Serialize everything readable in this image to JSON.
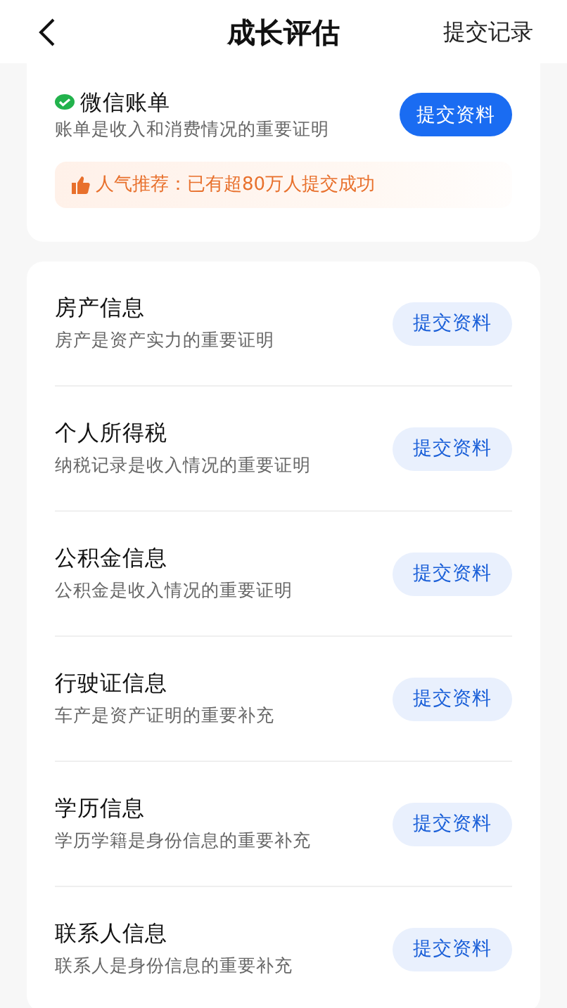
{
  "header": {
    "title": "成长评估",
    "action": "提交记录"
  },
  "featured": {
    "title": "微信账单",
    "subtitle": "账单是收入和消费情况的重要证明",
    "button": {
      "label": "提交资料",
      "kind": "primary"
    },
    "notice": "人气推荐：已有超80万人提交成功"
  },
  "items": [
    {
      "title": "房产信息",
      "subtitle": "房产是资产实力的重要证明",
      "button": {
        "label": "提交资料",
        "kind": "light"
      }
    },
    {
      "title": "个人所得税",
      "subtitle": "纳税记录是收入情况的重要证明",
      "button": {
        "label": "提交资料",
        "kind": "light"
      }
    },
    {
      "title": "公积金信息",
      "subtitle": "公积金是收入情况的重要证明",
      "button": {
        "label": "提交资料",
        "kind": "light"
      }
    },
    {
      "title": "行驶证信息",
      "subtitle": "车产是资产证明的重要补充",
      "button": {
        "label": "提交资料",
        "kind": "light"
      }
    },
    {
      "title": "学历信息",
      "subtitle": "学历学籍是身份信息的重要补充",
      "button": {
        "label": "提交资料",
        "kind": "light"
      }
    },
    {
      "title": "联系人信息",
      "subtitle": "联系人是身份信息的重要补充",
      "button": {
        "label": "提交资料",
        "kind": "light"
      }
    }
  ]
}
